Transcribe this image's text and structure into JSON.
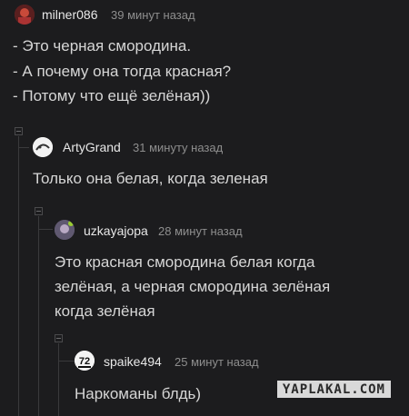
{
  "comments": [
    {
      "username": "milner086",
      "time": "39 минут назад",
      "lines": [
        "- Это черная смородина.",
        "- А почему она тогда красная?",
        "- Потому что ещё зелёная))"
      ],
      "avatar_color": "#b23a3a"
    },
    {
      "username": "ArtyGrand",
      "time": "31 минуту назад",
      "lines": [
        "Только она белая, когда зеленая"
      ],
      "avatar_color": "#e8e8e8"
    },
    {
      "username": "uzkayajopa",
      "time": "28 минут назад",
      "lines": [
        "Это красная смородина белая когда",
        "зелёная, а черная смородина зелёная",
        "когда зелёная"
      ],
      "avatar_color": "#7a6f8a"
    },
    {
      "username": "spaike494",
      "time": "25 минут назад",
      "lines": [
        "Наркоманы блдь)"
      ],
      "avatar_color": "#f0f0f0",
      "avatar_text": "72"
    }
  ],
  "watermark": "YAPLAKAL.COM"
}
